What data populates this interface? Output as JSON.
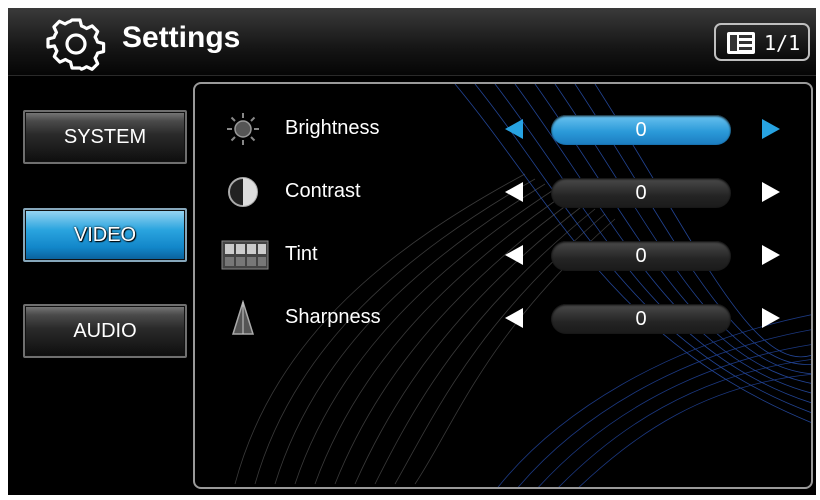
{
  "header": {
    "title": "Settings",
    "page_indicator": "1/1"
  },
  "sidebar": {
    "items": [
      {
        "label": "SYSTEM",
        "selected": false
      },
      {
        "label": "VIDEO",
        "selected": true
      },
      {
        "label": "AUDIO",
        "selected": false
      }
    ]
  },
  "settings": [
    {
      "label": "Brightness",
      "value": "0",
      "icon": "sun-icon",
      "focused": true
    },
    {
      "label": "Contrast",
      "value": "0",
      "icon": "contrast-icon",
      "focused": false
    },
    {
      "label": "Tint",
      "value": "0",
      "icon": "tint-icon",
      "focused": false
    },
    {
      "label": "Sharpness",
      "value": "0",
      "icon": "sharpness-icon",
      "focused": false
    }
  ],
  "colors": {
    "accent": "#27a3e2",
    "background": "#000000",
    "text": "#ffffff"
  }
}
